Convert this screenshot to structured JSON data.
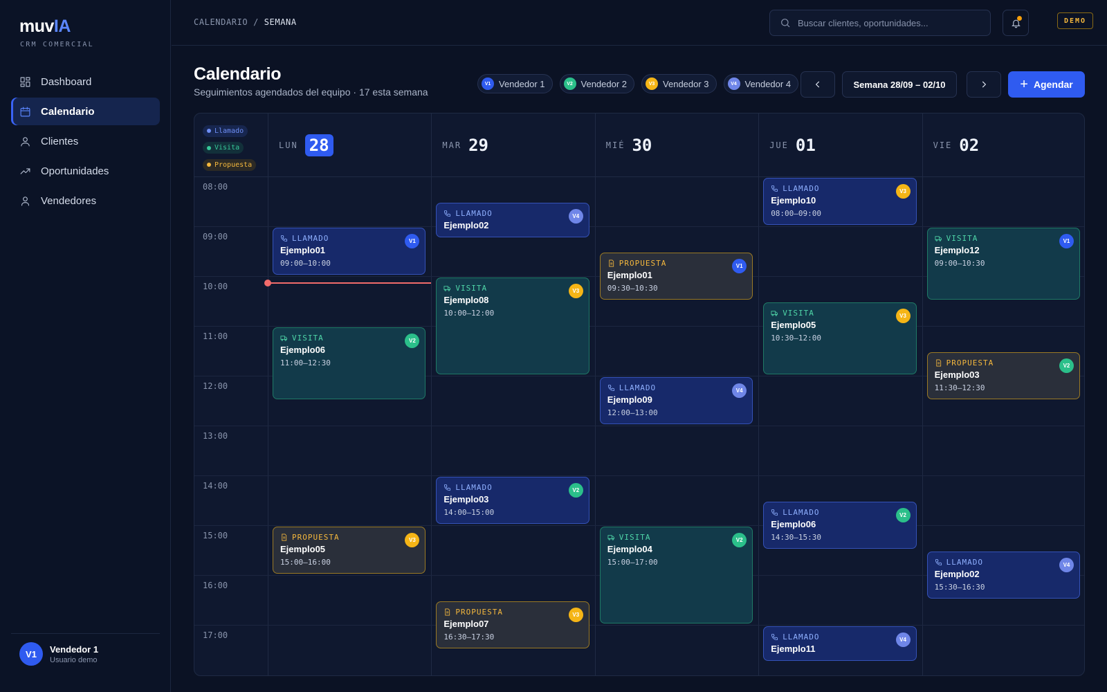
{
  "brand": {
    "name_a": "muv",
    "name_b": "IA",
    "tagline": "CRM COMERCIAL"
  },
  "nav": [
    {
      "label": "Dashboard",
      "icon": "dashboard-icon",
      "active": false
    },
    {
      "label": "Calendario",
      "icon": "calendar-icon",
      "active": true
    },
    {
      "label": "Clientes",
      "icon": "clients-icon",
      "active": false
    },
    {
      "label": "Oportunidades",
      "icon": "trend-icon",
      "active": false
    },
    {
      "label": "Vendedores",
      "icon": "user-icon",
      "active": false
    }
  ],
  "user": {
    "initials": "V1",
    "name": "Vendedor 1",
    "role": "Usuario demo"
  },
  "topbar": {
    "breadcrumb_root": "CALENDARIO",
    "breadcrumb_sep": " / ",
    "breadcrumb_current": "SEMANA",
    "search_placeholder": "Buscar clientes, oportunidades...",
    "badge": "DEMO"
  },
  "header": {
    "title": "Calendario",
    "subtitle": "Seguimientos agendados del equipo · 17 esta semana",
    "week_label": "Semana 28/09 – 02/10",
    "add_label": "Agendar"
  },
  "vendors": [
    {
      "code": "V1",
      "name": "Vendedor 1",
      "color": "#2f5bf0"
    },
    {
      "code": "V2",
      "name": "Vendedor 2",
      "color": "#2bbf8a"
    },
    {
      "code": "V3",
      "name": "Vendedor 3",
      "color": "#f5b516"
    },
    {
      "code": "V4",
      "name": "Vendedor 4",
      "color": "#6f86e8"
    }
  ],
  "types": [
    {
      "key": "llamado",
      "label": "Llamado",
      "color": "#6f8ff5",
      "bg": "#17264f"
    },
    {
      "key": "visita",
      "label": "Visita",
      "color": "#37c99a",
      "bg": "#12303a"
    },
    {
      "key": "propuesta",
      "label": "Propuesta",
      "color": "#f5b83d",
      "bg": "#2c2a25"
    }
  ],
  "type_labels": {
    "llamado": "LLAMADO",
    "visita": "VISITA",
    "propuesta": "PROPUESTA"
  },
  "days": [
    {
      "name": "LUN",
      "num": "28",
      "today": true
    },
    {
      "name": "MAR",
      "num": "29",
      "today": false
    },
    {
      "name": "MIÉ",
      "num": "30",
      "today": false
    },
    {
      "name": "JUE",
      "num": "01",
      "today": false
    },
    {
      "name": "VIE",
      "num": "02",
      "today": false
    }
  ],
  "hours": [
    "08:00",
    "09:00",
    "10:00",
    "11:00",
    "12:00",
    "13:00",
    "14:00",
    "15:00",
    "16:00",
    "17:00"
  ],
  "now": {
    "day": 0,
    "hour": 10.12
  },
  "events": [
    {
      "day": 0,
      "start": 9,
      "end": 10,
      "type": "llamado",
      "title": "Ejemplo01",
      "time": "09:00–10:00",
      "vendor": "V1"
    },
    {
      "day": 0,
      "start": 11,
      "end": 12.5,
      "type": "visita",
      "title": "Ejemplo06",
      "time": "11:00–12:30",
      "vendor": "V2"
    },
    {
      "day": 0,
      "start": 15,
      "end": 16,
      "type": "propuesta",
      "title": "Ejemplo05",
      "time": "15:00–16:00",
      "vendor": "V3"
    },
    {
      "day": 1,
      "start": 8.5,
      "end": 9.25,
      "type": "llamado",
      "title": "Ejemplo02",
      "time": "",
      "vendor": "V4"
    },
    {
      "day": 1,
      "start": 10,
      "end": 12,
      "type": "visita",
      "title": "Ejemplo08",
      "time": "10:00–12:00",
      "vendor": "V3"
    },
    {
      "day": 1,
      "start": 14,
      "end": 15,
      "type": "llamado",
      "title": "Ejemplo03",
      "time": "14:00–15:00",
      "vendor": "V2"
    },
    {
      "day": 1,
      "start": 16.5,
      "end": 17.5,
      "type": "propuesta",
      "title": "Ejemplo07",
      "time": "16:30–17:30",
      "vendor": "V3"
    },
    {
      "day": 2,
      "start": 9.5,
      "end": 10.5,
      "type": "propuesta",
      "title": "Ejemplo01",
      "time": "09:30–10:30",
      "vendor": "V1"
    },
    {
      "day": 2,
      "start": 12,
      "end": 13,
      "type": "llamado",
      "title": "Ejemplo09",
      "time": "12:00–13:00",
      "vendor": "V4"
    },
    {
      "day": 2,
      "start": 15,
      "end": 17,
      "type": "visita",
      "title": "Ejemplo04",
      "time": "15:00–17:00",
      "vendor": "V2"
    },
    {
      "day": 3,
      "start": 8,
      "end": 9,
      "type": "llamado",
      "title": "Ejemplo10",
      "time": "08:00–09:00",
      "vendor": "V3"
    },
    {
      "day": 3,
      "start": 10.5,
      "end": 12,
      "type": "visita",
      "title": "Ejemplo05",
      "time": "10:30–12:00",
      "vendor": "V3"
    },
    {
      "day": 3,
      "start": 14.5,
      "end": 15.5,
      "type": "llamado",
      "title": "Ejemplo06",
      "time": "14:30–15:30",
      "vendor": "V2"
    },
    {
      "day": 3,
      "start": 17,
      "end": 17.75,
      "type": "llamado",
      "title": "Ejemplo11",
      "time": "",
      "vendor": "V4"
    },
    {
      "day": 4,
      "start": 9,
      "end": 10.5,
      "type": "visita",
      "title": "Ejemplo12",
      "time": "09:00–10:30",
      "vendor": "V1"
    },
    {
      "day": 4,
      "start": 11.5,
      "end": 12.5,
      "type": "propuesta",
      "title": "Ejemplo03",
      "time": "11:30–12:30",
      "vendor": "V2"
    },
    {
      "day": 4,
      "start": 15.5,
      "end": 16.5,
      "type": "llamado",
      "title": "Ejemplo02",
      "time": "15:30–16:30",
      "vendor": "V4"
    }
  ]
}
